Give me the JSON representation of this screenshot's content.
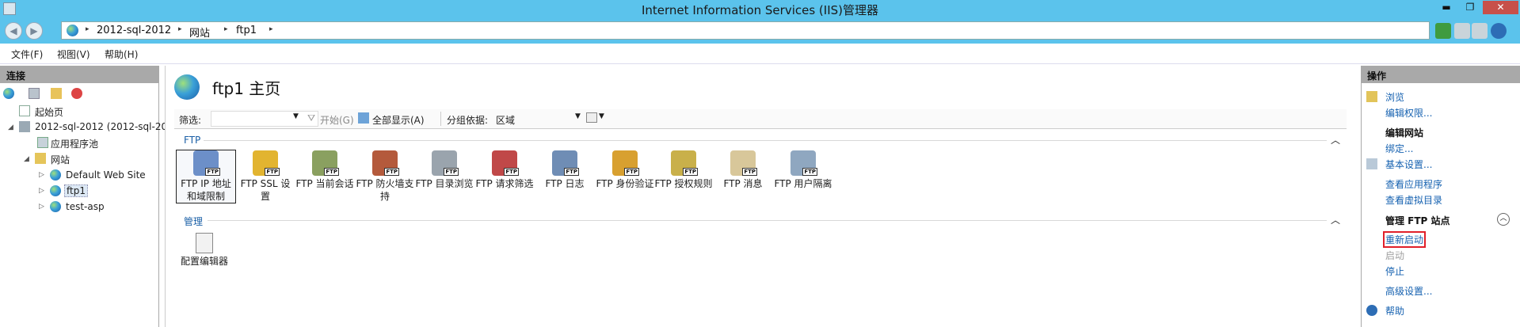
{
  "window": {
    "title": "Internet Information Services (IIS)管理器",
    "controls": {
      "minimize": "▬",
      "restore": "❐",
      "close": "✕"
    }
  },
  "address": {
    "crumbs": [
      "2012-sql-2012",
      "网站",
      "ftp1"
    ]
  },
  "menu": [
    "文件(F)",
    "视图(V)",
    "帮助(H)"
  ],
  "connections": {
    "header": "连接",
    "tree": [
      {
        "label": "起始页",
        "icon": "start-page-icon"
      },
      {
        "label": "2012-sql-2012 (2012-sql-20",
        "icon": "server-icon",
        "toggle": "◢"
      },
      {
        "label": "应用程序池",
        "icon": "app-pools-icon"
      },
      {
        "label": "网站",
        "icon": "sites-folder-icon",
        "toggle": "◢"
      },
      {
        "label": "Default Web Site",
        "icon": "globe-icon",
        "toggle": "▷"
      },
      {
        "label": "ftp1",
        "icon": "globe-icon",
        "toggle": "▷"
      },
      {
        "label": "test-asp",
        "icon": "globe-icon",
        "toggle": "▷"
      }
    ]
  },
  "center": {
    "title": "ftp1 主页",
    "filter": {
      "label": "筛选:",
      "go": "开始(G)",
      "show_all": "全部显示(A)",
      "group_by_label": "分组依据:",
      "group_by_value": "区域"
    },
    "sections": [
      {
        "name": "FTP",
        "items": [
          {
            "label": "FTP IP 地址和域限制",
            "icon": "ftp-ip-restrictions-icon"
          },
          {
            "label": "FTP SSL 设置",
            "icon": "ftp-ssl-icon"
          },
          {
            "label": "FTP 当前会话",
            "icon": "ftp-sessions-icon"
          },
          {
            "label": "FTP 防火墙支持",
            "icon": "ftp-firewall-icon"
          },
          {
            "label": "FTP 目录浏览",
            "icon": "ftp-directory-browsing-icon"
          },
          {
            "label": "FTP 请求筛选",
            "icon": "ftp-request-filtering-icon"
          },
          {
            "label": "FTP 日志",
            "icon": "ftp-logging-icon"
          },
          {
            "label": "FTP 身份验证",
            "icon": "ftp-authentication-icon"
          },
          {
            "label": "FTP 授权规则",
            "icon": "ftp-authorization-icon"
          },
          {
            "label": "FTP 消息",
            "icon": "ftp-messages-icon"
          },
          {
            "label": "FTP 用户隔离",
            "icon": "ftp-user-isolation-icon"
          }
        ]
      },
      {
        "name": "管理",
        "items": [
          {
            "label": "配置编辑器",
            "icon": "config-editor-icon"
          }
        ]
      }
    ],
    "ftp_badge": "FTP",
    "collapse": "︿"
  },
  "actions": {
    "header": "操作",
    "items": [
      {
        "label": "浏览",
        "icon": "browse-icon"
      },
      {
        "label": "编辑权限..."
      },
      {
        "label": "编辑网站",
        "group": true
      },
      {
        "label": "绑定..."
      },
      {
        "label": "基本设置...",
        "icon": "basic-settings-icon"
      },
      {
        "label": "查看应用程序"
      },
      {
        "label": "查看虚拟目录"
      },
      {
        "label": "管理 FTP 站点",
        "group": true
      },
      {
        "label": "重新启动",
        "highlighted": true
      },
      {
        "label": "启动",
        "disabled": true
      },
      {
        "label": "停止"
      },
      {
        "label": "高级设置..."
      },
      {
        "label": "帮助",
        "icon": "help-icon"
      }
    ]
  },
  "colors": {
    "titlebar": "#5bc3ec",
    "link": "#1561b0",
    "highlight_box": "#e0202a"
  }
}
